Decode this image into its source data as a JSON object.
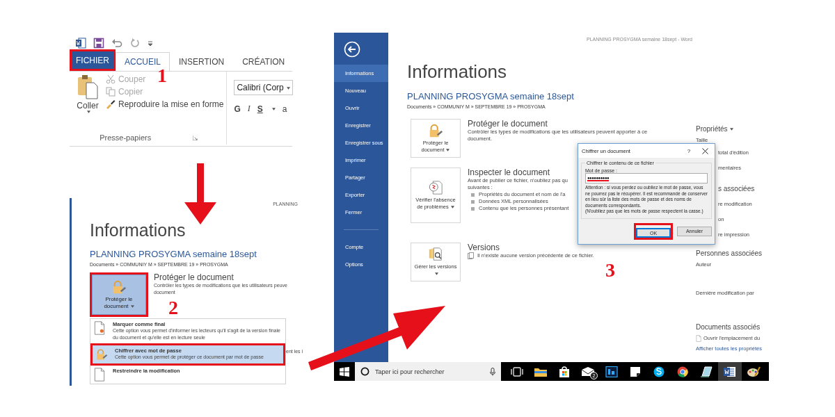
{
  "ribbon": {
    "tabs": [
      {
        "label": "FICHIER",
        "kind": "file",
        "selected": false,
        "highlighted": true
      },
      {
        "label": "ACCUEIL",
        "kind": "tab",
        "selected": true,
        "highlighted": false
      },
      {
        "label": "INSERTION",
        "kind": "tab",
        "selected": false,
        "highlighted": false
      },
      {
        "label": "CRÉATION",
        "kind": "tab",
        "selected": false,
        "highlighted": false
      }
    ],
    "paste_label": "Coller",
    "clipboard_items": [
      {
        "label": "Couper",
        "kind": "cut",
        "disabled": true
      },
      {
        "label": "Copier",
        "kind": "copy",
        "disabled": true
      },
      {
        "label": "Reproduire la mise en forme",
        "kind": "brush",
        "disabled": false
      }
    ],
    "group_label": "Presse-papiers",
    "font_name": "Calibri (Corp",
    "format_buttons": [
      {
        "label": "G",
        "kind": "bold"
      },
      {
        "label": "I",
        "kind": "italic"
      },
      {
        "label": "S",
        "kind": "underline"
      },
      {
        "label": "a",
        "kind": "plain"
      }
    ]
  },
  "step_markers": [
    "1",
    "2",
    "3"
  ],
  "zoomed_info": {
    "title_bar": "PLANNING",
    "heading": "Informations",
    "document_title": "PLANNING PROSYGMA semaine 18sept",
    "breadcrumb": "Documents » COMMUNIY M » SEPTEMBRE 19 » PROSYGMA",
    "protect_button": {
      "label": "Protéger le document",
      "selected": true,
      "highlighted": true
    },
    "protect_title": "Protéger le document",
    "protect_description": [
      "Contrôler les types de modifications que les utilisateurs peuve",
      "document"
    ],
    "background_text": "ent les i",
    "protect_menu": [
      {
        "title": "Marquer comme final",
        "kind": "final",
        "description": "Cette option vous permet d'informer les lecteurs qu'il s'agit de la version finale du document et qu'elle est en lecture seule",
        "selected": false,
        "highlighted": false
      },
      {
        "title": "Chiffrer avec mot de passe",
        "kind": "encrypt",
        "description": "Cette option vous permet de protéger ce document par mot de passe",
        "selected": true,
        "highlighted": true
      },
      {
        "title": "Restreindre la modification",
        "kind": "restrict",
        "selected": false,
        "highlighted": false
      }
    ]
  },
  "backstage": {
    "window_title": "PLANNING PROSYGMA semaine 18sept - Word",
    "nav": [
      {
        "label": "Informations",
        "selected": true
      },
      {
        "label": "Nouveau",
        "selected": false
      },
      {
        "label": "Ouvrir",
        "selected": false
      },
      {
        "label": "Enregistrer",
        "selected": false
      },
      {
        "label": "Enregistrer sous",
        "selected": false
      },
      {
        "label": "Imprimer",
        "selected": false
      },
      {
        "label": "Partager",
        "selected": false
      },
      {
        "label": "Exporter",
        "selected": false
      },
      {
        "label": "Fermer",
        "selected": false
      }
    ],
    "nav_footer": [
      {
        "label": "Compte",
        "selected": false
      },
      {
        "label": "Options",
        "selected": false
      }
    ],
    "heading": "Informations",
    "document_title": "PLANNING PROSYGMA semaine 18sept",
    "breadcrumb": "Documents » COMMUNIY M » SEPTEMBRE 19 » PROSYGMA",
    "sections": [
      {
        "kind": "protect",
        "button": "Protéger le document",
        "title": "Protéger le document",
        "lines": [
          "Contrôler les types de modifications que les utilisateurs peuvent apporter à ce",
          "document."
        ]
      },
      {
        "kind": "inspect",
        "button": "Vérifier l'absence de problèmes",
        "title": "Inspecter le document",
        "lines": [
          "Avant de publier ce fichier, n'oubliez pas qu",
          "suivantes :"
        ],
        "bullets": [
          "Propriétés du document et nom de l'a",
          "Données XML personnalisées",
          "Contenu que les personnes présentant"
        ]
      },
      {
        "kind": "versions",
        "button": "Gérer les versions",
        "title": "Versions",
        "note": "Il n'existe aucune version précédente de ce fichier."
      }
    ],
    "properties": [
      {
        "text": "Propriétés",
        "kind": "menu-heading"
      },
      {
        "text": "Taille",
        "kind": "label"
      },
      {
        "text": "total d'édition",
        "kind": "partial"
      },
      {
        "text": "mentaires",
        "kind": "partial"
      },
      {
        "text": "s associées",
        "kind": "partial-heading"
      },
      {
        "text": "re modification",
        "kind": "partial"
      },
      {
        "text": "on",
        "kind": "partial"
      },
      {
        "text": "re impression",
        "kind": "partial"
      },
      {
        "text": "Personnes associées",
        "kind": "heading"
      },
      {
        "text": "Auteur",
        "kind": "field"
      },
      {
        "text": "Dernière modification par",
        "kind": "field"
      },
      {
        "text": "Documents associés",
        "kind": "heading"
      },
      {
        "text": "Ouvrir l'emplacement du",
        "kind": "file"
      },
      {
        "text": "Afficher toutes les propriétés",
        "kind": "link"
      }
    ]
  },
  "dialog": {
    "title": "Chiffrer un document",
    "help": "?",
    "group_label": "Chiffrer le contenu de ce fichier",
    "field_label": "Mot de passe :",
    "value": "●●●●●●●●●●",
    "warning": "Attention : si vous perdez ou oubliez le mot de passe, vous ne pourrez pas le récupérer. Il est recommandé de conserver en lieu sûr la liste des mots de passe et des noms de documents correspondants.",
    "note": "(N'oubliez pas que les mots de passe respectent la casse.)",
    "buttons": [
      {
        "label": "OK",
        "kind": "default",
        "highlighted": true
      },
      {
        "label": "Annuler",
        "kind": "normal",
        "highlighted": false
      }
    ]
  },
  "taskbar": {
    "search_placeholder": "Taper ici pour rechercher",
    "apps": [
      {
        "kind": "task-view",
        "selected": false
      },
      {
        "kind": "folder",
        "selected": false
      },
      {
        "kind": "store",
        "selected": false
      },
      {
        "kind": "mail",
        "selected": false,
        "badge": "2"
      },
      {
        "kind": "photo-editor",
        "selected": false
      },
      {
        "kind": "sticky-note",
        "selected": false
      },
      {
        "kind": "chat",
        "selected": false
      },
      {
        "kind": "browser",
        "selected": false
      },
      {
        "kind": "notebook",
        "selected": false
      },
      {
        "kind": "word",
        "selected": true
      },
      {
        "kind": "paint",
        "selected": false
      }
    ]
  }
}
